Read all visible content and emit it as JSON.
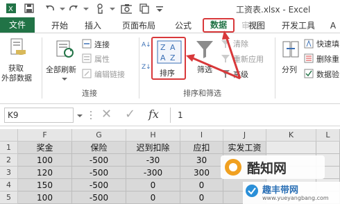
{
  "title": "工资表.xlsx - Excel",
  "tabs": {
    "file": "文件",
    "home": "开始",
    "insert": "插入",
    "layout": "页面布局",
    "formulas": "公式",
    "data": "数据",
    "review": "审阅",
    "view": "视图",
    "developer": "开发工具",
    "overflow": "A"
  },
  "ribbon": {
    "get_external": "获取\n外部数据",
    "get_external_line1": "获取",
    "get_external_line2": "外部数据",
    "refresh_all": "全部刷新",
    "connections": "连接",
    "properties": "属性",
    "edit_links": "编辑链接",
    "group_connections": "连接",
    "sort_az": "A↓Z",
    "sort_za": "Z↓A",
    "sort": "排序",
    "filter": "筛选",
    "clear": "清除",
    "reapply": "重新应用",
    "advanced": "高级",
    "group_sort_filter": "排序和筛选",
    "text_to_columns": "分列",
    "flash_fill": "快速填",
    "remove_duplicates": "删除重",
    "data_validation": "数据验"
  },
  "formula_bar": {
    "name_box": "K9",
    "cancel": "✕",
    "enter": "✓",
    "fx": "fx",
    "value": "1"
  },
  "columns": [
    "F",
    "G",
    "H",
    "I",
    "J",
    "K",
    "L"
  ],
  "rows": [
    {
      "num": "1",
      "cells": [
        "奖金",
        "保险",
        "迟到扣除",
        "应扣",
        "实发工资",
        "",
        ""
      ]
    },
    {
      "num": "2",
      "cells": [
        "100",
        "-500",
        "-30",
        "30",
        "",
        "",
        ""
      ]
    },
    {
      "num": "3",
      "cells": [
        "120",
        "-500",
        "-300",
        "300",
        "",
        "",
        ""
      ]
    },
    {
      "num": "4",
      "cells": [
        "150",
        "-500",
        "0",
        "0",
        "",
        "",
        ""
      ]
    },
    {
      "num": "5",
      "cells": [
        "100",
        "-500",
        "0",
        "0",
        "",
        "",
        ""
      ]
    }
  ],
  "watermark": {
    "brand": "酷知网",
    "site": "www.yueyangbang.com",
    "site_cn": "趣丰带网"
  },
  "colors": {
    "excel_green": "#217346",
    "highlight_red": "#d8383a",
    "cell_grey": "#d9d9d9"
  }
}
